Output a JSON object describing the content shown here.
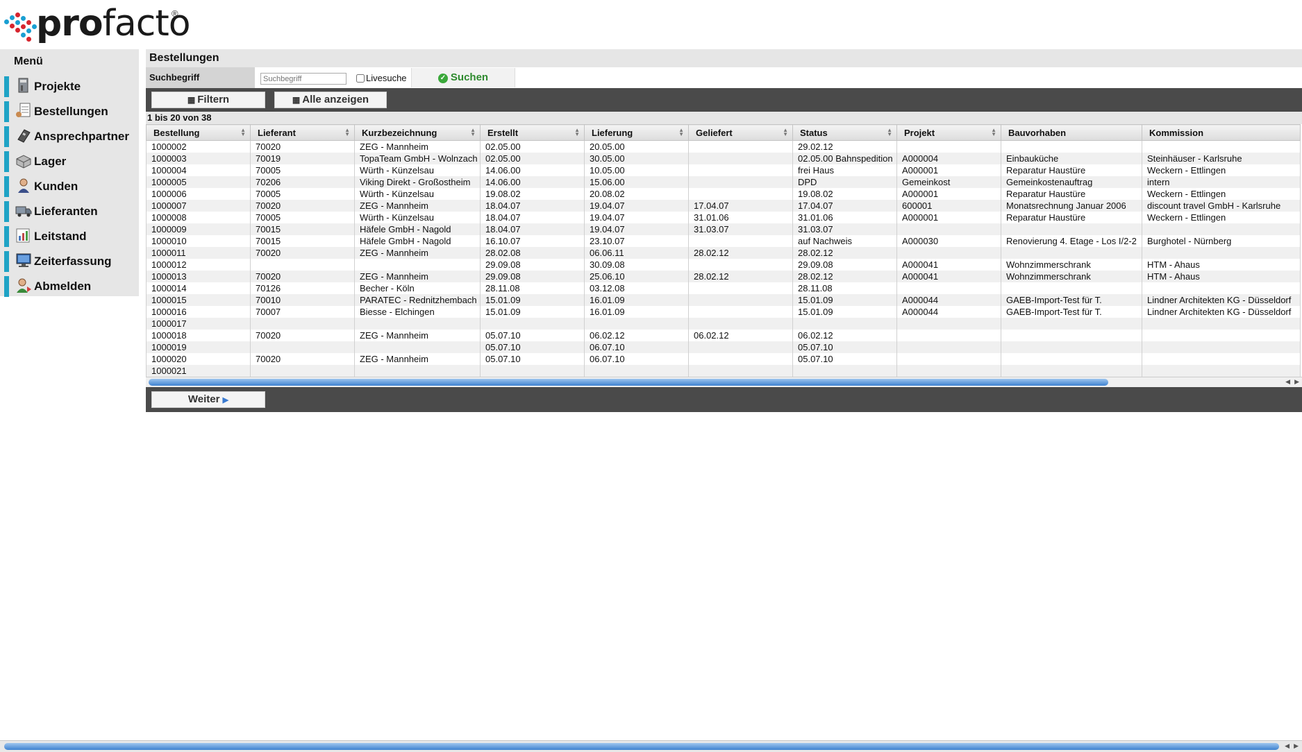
{
  "logo": {
    "text_bold": "pro",
    "text_rest": "facto",
    "reg": "®"
  },
  "sidebar": {
    "title": "Menü",
    "items": [
      {
        "label": "Projekte",
        "icon": "binder-icon"
      },
      {
        "label": "Bestellungen",
        "icon": "order-list-icon"
      },
      {
        "label": "Ansprechpartner",
        "icon": "phone-icon"
      },
      {
        "label": "Lager",
        "icon": "box-icon"
      },
      {
        "label": "Kunden",
        "icon": "person-icon"
      },
      {
        "label": "Lieferanten",
        "icon": "truck-icon"
      },
      {
        "label": "Leitstand",
        "icon": "chart-icon"
      },
      {
        "label": "Zeiterfassung",
        "icon": "monitor-icon"
      },
      {
        "label": "Abmelden",
        "icon": "logout-person-icon"
      }
    ]
  },
  "main": {
    "title": "Bestellungen",
    "search": {
      "label": "Suchbegriff",
      "placeholder": "Suchbegriff",
      "livesearch_label": "Livesuche",
      "button": "Suchen"
    },
    "toolbar": {
      "filter": "Filtern",
      "show_all": "Alle anzeigen"
    },
    "count": "1 bis 20 von 38",
    "columns": [
      "Bestellung",
      "Lieferant",
      "Kurzbezeichnung",
      "Erstellt",
      "Lieferung",
      "Geliefert",
      "Status",
      "Projekt",
      "Bauvorhaben",
      "Kommission"
    ],
    "rows": [
      [
        "1000002",
        "70020",
        "ZEG - Mannheim",
        "02.05.00",
        "20.05.00",
        "",
        "29.02.12",
        "",
        "",
        ""
      ],
      [
        "1000003",
        "70019",
        "TopaTeam GmbH - Wolnzach",
        "02.05.00",
        "30.05.00",
        "",
        "02.05.00 Bahnspedition",
        "A000004",
        "Einbauküche",
        "Steinhäuser - Karlsruhe"
      ],
      [
        "1000004",
        "70005",
        "Würth - Künzelsau",
        "14.06.00",
        "10.05.00",
        "",
        "frei Haus",
        "A000001",
        "Reparatur Haustüre",
        "Weckern - Ettlingen"
      ],
      [
        "1000005",
        "70206",
        "Viking Direkt - Großostheim",
        "14.06.00",
        "15.06.00",
        "",
        "DPD",
        "Gemeinkost",
        "Gemeinkostenauftrag",
        "intern"
      ],
      [
        "1000006",
        "70005",
        "Würth - Künzelsau",
        "19.08.02",
        "20.08.02",
        "",
        "19.08.02",
        "A000001",
        "Reparatur Haustüre",
        "Weckern - Ettlingen"
      ],
      [
        "1000007",
        "70020",
        "ZEG - Mannheim",
        "18.04.07",
        "19.04.07",
        "17.04.07",
        "17.04.07",
        "600001",
        "Monatsrechnung Januar 2006",
        "discount travel GmbH - Karlsruhe"
      ],
      [
        "1000008",
        "70005",
        "Würth - Künzelsau",
        "18.04.07",
        "19.04.07",
        "31.01.06",
        "31.01.06",
        "A000001",
        "Reparatur Haustüre",
        "Weckern - Ettlingen"
      ],
      [
        "1000009",
        "70015",
        "Häfele GmbH - Nagold",
        "18.04.07",
        "19.04.07",
        "31.03.07",
        "31.03.07",
        "",
        "",
        ""
      ],
      [
        "1000010",
        "70015",
        "Häfele GmbH - Nagold",
        "16.10.07",
        "23.10.07",
        "",
        "auf Nachweis",
        "A000030",
        "Renovierung 4. Etage - Los I/2-2",
        "Burghotel - Nürnberg"
      ],
      [
        "1000011",
        "70020",
        "ZEG - Mannheim",
        "28.02.08",
        "06.06.11",
        "28.02.12",
        "28.02.12",
        "",
        "",
        ""
      ],
      [
        "1000012",
        "",
        "",
        "29.09.08",
        "30.09.08",
        "",
        "29.09.08",
        "A000041",
        "Wohnzimmerschrank",
        "HTM - Ahaus"
      ],
      [
        "1000013",
        "70020",
        "ZEG - Mannheim",
        "29.09.08",
        "25.06.10",
        "28.02.12",
        "28.02.12",
        "A000041",
        "Wohnzimmerschrank",
        "HTM - Ahaus"
      ],
      [
        "1000014",
        "70126",
        "Becher - Köln",
        "28.11.08",
        "03.12.08",
        "",
        "28.11.08",
        "",
        "",
        ""
      ],
      [
        "1000015",
        "70010",
        "PARATEC - Rednitzhembach",
        "15.01.09",
        "16.01.09",
        "",
        "15.01.09",
        "A000044",
        "GAEB-Import-Test für T.",
        "Lindner Architekten KG - Düsseldorf"
      ],
      [
        "1000016",
        "70007",
        "Biesse - Elchingen",
        "15.01.09",
        "16.01.09",
        "",
        "15.01.09",
        "A000044",
        "GAEB-Import-Test für T.",
        "Lindner Architekten KG - Düsseldorf"
      ],
      [
        "1000017",
        "",
        "",
        "",
        "",
        "",
        "",
        "",
        "",
        ""
      ],
      [
        "1000018",
        "70020",
        "ZEG - Mannheim",
        "05.07.10",
        "06.02.12",
        "06.02.12",
        "06.02.12",
        "",
        "",
        ""
      ],
      [
        "1000019",
        "",
        "",
        "05.07.10",
        "06.07.10",
        "",
        "05.07.10",
        "",
        "",
        ""
      ],
      [
        "1000020",
        "70020",
        "ZEG - Mannheim",
        "05.07.10",
        "06.07.10",
        "",
        "05.07.10",
        "",
        "",
        ""
      ],
      [
        "1000021",
        "",
        "",
        "",
        "",
        "",
        "",
        "",
        "",
        ""
      ]
    ],
    "next_button": "Weiter"
  },
  "colors": {
    "accent": "#1fa3c5",
    "toolbar": "#4a4a4a",
    "panel": "#e6e6e6",
    "success": "#2e8a2e"
  }
}
